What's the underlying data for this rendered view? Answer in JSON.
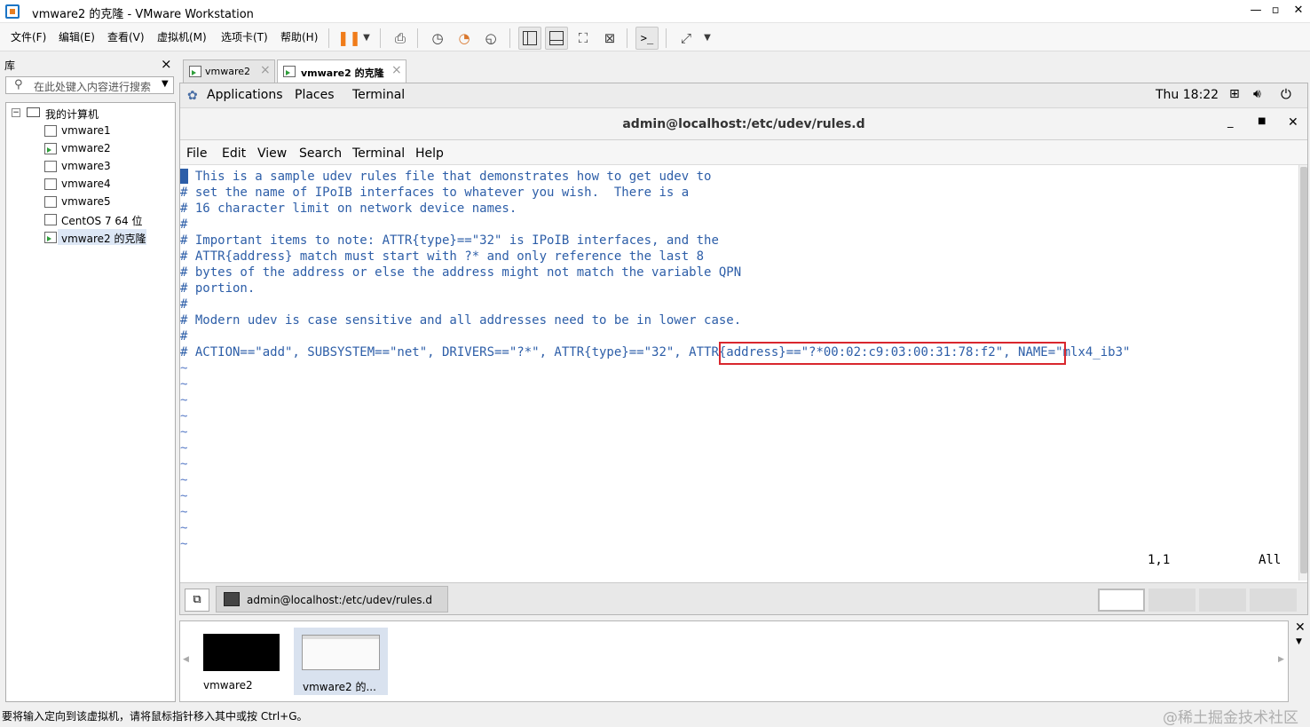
{
  "window": {
    "title": "vmware2 的克隆 - VMware Workstation"
  },
  "menu": [
    "文件(F)",
    "编辑(E)",
    "查看(V)",
    "虚拟机(M)",
    "选项卡(T)",
    "帮助(H)"
  ],
  "toolbar_icons": [
    "pause-icon",
    "dropdown-icon",
    "send-keys-icon",
    "snapshot-icon",
    "revert-snapshot-icon",
    "snapshot-manager-icon",
    "library-view-icon",
    "thumbnail-view-icon",
    "fullscreen-icon",
    "unity-icon",
    "console-icon",
    "stretch-icon"
  ],
  "library": {
    "title": "库",
    "close": "×",
    "search_placeholder": "在此处键入内容进行搜索",
    "root": "我的计算机",
    "items": [
      "vmware1",
      "vmware2",
      "vmware3",
      "vmware4",
      "vmware5",
      "CentOS 7 64 位",
      "vmware2 的克隆"
    ]
  },
  "tabs": [
    {
      "label": "vmware2",
      "close": "×"
    },
    {
      "label": "vmware2 的克隆",
      "close": "×"
    }
  ],
  "gnome": {
    "applications": "Applications",
    "places": "Places",
    "terminal": "Terminal",
    "clock": "Thu 18:22"
  },
  "terminal": {
    "title": "admin@localhost:/etc/udev/rules.d",
    "menu": [
      "File",
      "Edit",
      "View",
      "Search",
      "Terminal",
      "Help"
    ],
    "lines": [
      "# This is a sample udev rules file that demonstrates how to get udev to",
      "# set the name of IPoIB interfaces to whatever you wish.  There is a",
      "# 16 character limit on network device names.",
      "#",
      "# Important items to note: ATTR{type}==\"32\" is IPoIB interfaces, and the",
      "# ATTR{address} match must start with ?* and only reference the last 8",
      "# bytes of the address or else the address might not match the variable QPN",
      "# portion.",
      "#",
      "# Modern udev is case sensitive and all addresses need to be in lower case.",
      "#",
      "# ACTION==\"add\", SUBSYSTEM==\"net\", DRIVERS==\"?*\", ATTR{type}==\"32\", ATTR{address}==\"?*00:02:c9:03:00:31:78:f2\", NAME=\"mlx4_ib3\""
    ],
    "tildes": [
      "~",
      "~",
      "~",
      "~",
      "~",
      "~",
      "~",
      "~",
      "~",
      "~",
      "~",
      "~"
    ],
    "cursor_pos": "1,1",
    "view_pos": "All",
    "highlight_color": "#d9272e"
  },
  "taskbar": {
    "window_label": "admin@localhost:/etc/udev/rules.d"
  },
  "thumbnails": [
    {
      "label": "vmware2"
    },
    {
      "label": "vmware2 的..."
    }
  ],
  "status": {
    "text": "要将输入定向到该虚拟机，请将鼠标指针移入其中或按 Ctrl+G。",
    "watermark": "@稀土掘金技术社区"
  }
}
